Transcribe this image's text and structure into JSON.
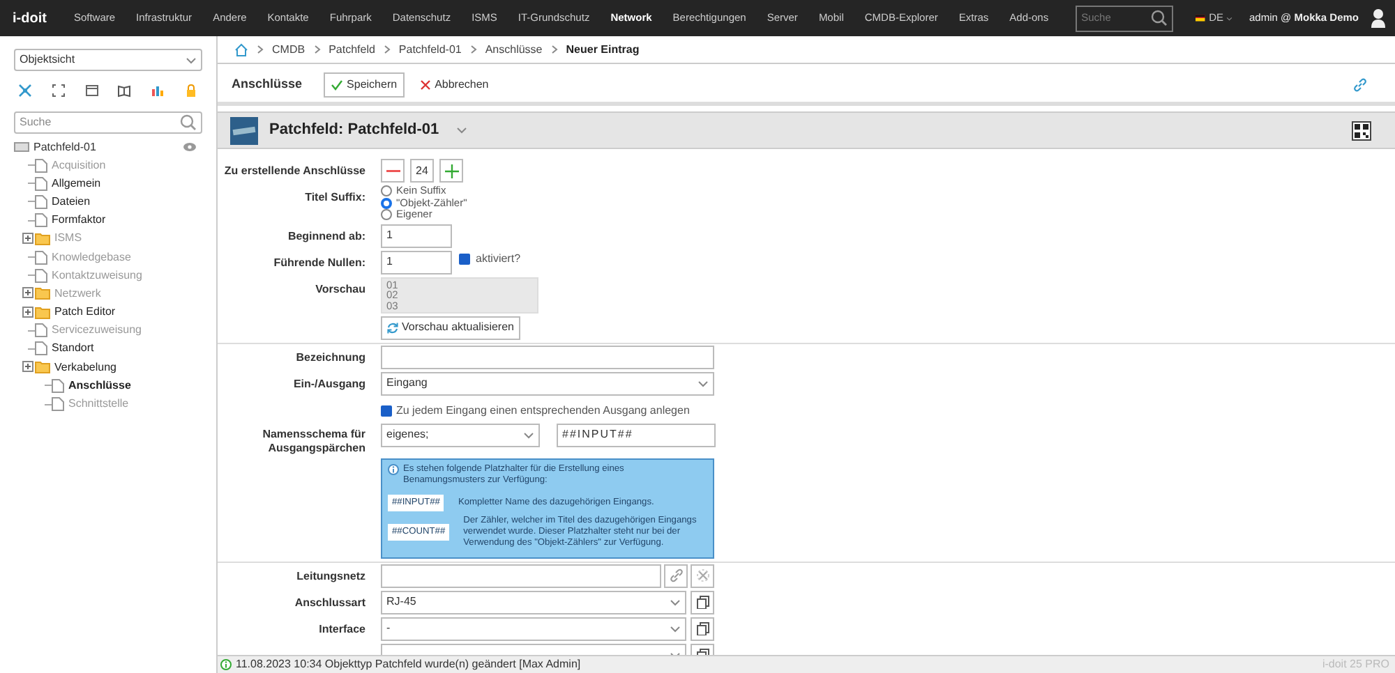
{
  "top_nav": {
    "logo": "i-doit",
    "menu": [
      {
        "label": "Software",
        "selected": false
      },
      {
        "label": "Infrastruktur",
        "selected": false
      },
      {
        "label": "Andere",
        "selected": false
      },
      {
        "label": "Kontakte",
        "selected": false
      },
      {
        "label": "Fuhrpark",
        "selected": false
      },
      {
        "label": "Datenschutz",
        "selected": false
      },
      {
        "label": "ISMS",
        "selected": false
      },
      {
        "label": "IT-Grundschutz",
        "selected": false
      },
      {
        "label": "Network",
        "selected": true
      },
      {
        "label": "Berechtigungen",
        "selected": false
      },
      {
        "label": "Server",
        "selected": false
      },
      {
        "label": "Mobil",
        "selected": false
      },
      {
        "label": "CMDB-Explorer",
        "selected": false
      },
      {
        "label": "Extras",
        "selected": false
      },
      {
        "label": "Add-ons",
        "selected": false
      }
    ],
    "search": {
      "placeholder": "Suche"
    },
    "language": "DE",
    "user": "admin @ **Mokka Demo**"
  },
  "sidebar": {
    "view_select": "Objektsicht",
    "search": {
      "placeholder": "Suche"
    },
    "tree": {
      "label": "Patchfeld-01",
      "children": [
        {
          "kind": "file",
          "label": "Acquisition",
          "enabled": false,
          "selected": false
        },
        {
          "kind": "file",
          "label": "Allgemein",
          "enabled": true,
          "selected": false
        },
        {
          "kind": "file",
          "label": "Dateien",
          "enabled": true,
          "selected": false
        },
        {
          "kind": "file",
          "label": "Formfaktor",
          "enabled": true,
          "selected": false
        },
        {
          "kind": "folder",
          "label": "ISMS",
          "enabled": false,
          "selected": false
        },
        {
          "kind": "file",
          "label": "Knowledgebase",
          "enabled": false,
          "selected": false
        },
        {
          "kind": "file",
          "label": "Kontaktzuweisung",
          "enabled": false,
          "selected": false
        },
        {
          "kind": "folder",
          "label": "Netzwerk",
          "enabled": false,
          "selected": false
        },
        {
          "kind": "folder",
          "label": "Patch Editor",
          "enabled": true,
          "selected": false
        },
        {
          "kind": "file",
          "label": "Servicezuweisung",
          "enabled": false,
          "selected": false
        },
        {
          "kind": "file",
          "label": "Standort",
          "enabled": true,
          "selected": false
        },
        {
          "kind": "folder",
          "label": "Verkabelung",
          "enabled": true,
          "selected": false,
          "children": [
            {
              "kind": "file",
              "label": "Anschlüsse",
              "enabled": true,
              "selected": true
            },
            {
              "kind": "file",
              "label": "Schnittstelle",
              "enabled": false,
              "selected": false
            }
          ]
        }
      ]
    }
  },
  "breadcrumb": [
    "CMDB",
    "Patchfeld",
    "Patchfeld-01",
    "Anschlüsse",
    "Neuer Eintrag"
  ],
  "toolbar": {
    "title": "Anschlüsse",
    "buttons": [
      {
        "kind": "save",
        "label": "Speichern"
      },
      {
        "kind": "cancel",
        "label": "Abbrechen"
      }
    ]
  },
  "object_header": {
    "title": "Patchfeld: Patchfeld-01"
  },
  "form": {
    "rows": [
      {
        "kind": "stepper",
        "label": "Zu erstellende Anschlüsse",
        "value": "24"
      },
      {
        "kind": "radio",
        "label": "Titel Suffix:",
        "options": [
          {
            "label": "Kein Suffix",
            "selected": false
          },
          {
            "label": "\"Objekt-Zähler\"",
            "selected": true
          },
          {
            "label": "Eigener",
            "selected": false
          }
        ]
      },
      {
        "kind": "short_input",
        "label": "Beginnend ab:",
        "value": "1"
      },
      {
        "kind": "short_input_check",
        "label": "Führende Nullen:",
        "value": "1",
        "check": {
          "label": "aktiviert?",
          "checked": true
        }
      },
      {
        "kind": "preview",
        "label": "Vorschau",
        "lines": [
          "01",
          "02",
          "03"
        ]
      },
      {
        "kind": "button",
        "label": "Vorschau aktualisieren"
      },
      {
        "kind": "divider"
      },
      {
        "kind": "input",
        "label": "Bezeichnung"
      },
      {
        "kind": "select",
        "label": "Ein-/Ausgang",
        "value": "Eingang"
      },
      {
        "kind": "checkbox",
        "label": "Zu jedem Eingang einen entsprechenden Ausgang anlegen",
        "checked": true
      },
      {
        "kind": "scheme",
        "label": "Namensschema für Ausgangspärchen",
        "select": "eigenes;",
        "value": "##INPUT##"
      },
      {
        "kind": "info",
        "text": "Es stehen folgende Platzhalter für die Erstellung eines Benamungsmusters zur Verfügung:",
        "placeholders": [
          {
            "code": "##INPUT##",
            "description": "Kompletter Name des dazugehörigen Eingangs."
          },
          {
            "code": "##COUNT##",
            "description": "Der Zähler, welcher im Titel des dazugehörigen Eingangs verwendet wurde. Dieser Platzhalter steht nur bei der Verwendung des \"Objekt-Zählers\" zur Verfügung."
          }
        ]
      },
      {
        "kind": "divider"
      },
      {
        "kind": "link_input",
        "label": "Leitungsnetz"
      },
      {
        "kind": "select_copy",
        "label": "Anschlussart",
        "value": "RJ-45"
      },
      {
        "kind": "select_copy",
        "label": "Interface",
        "value": "-"
      },
      {
        "kind": "select_copy"
      }
    ]
  },
  "status_bar": {
    "message": "11.08.2023 10:34 Objekttyp Patchfeld wurde(n) geändert [Max Admin]",
    "version": "i-doit 25 PRO"
  }
}
